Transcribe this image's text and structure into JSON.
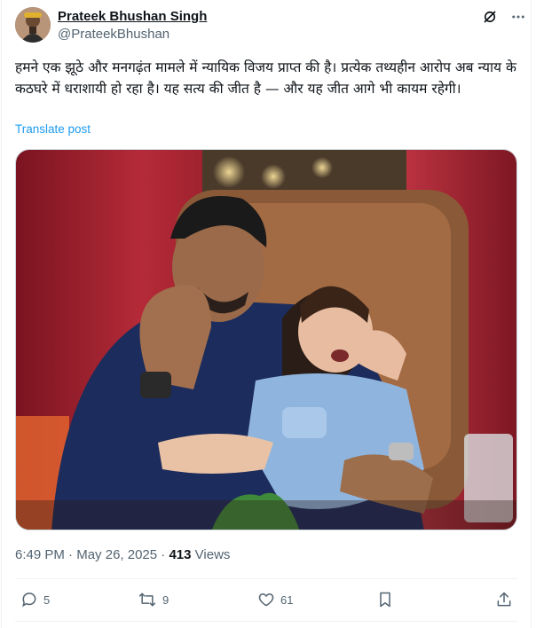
{
  "author": {
    "display_name": "Prateek Bhushan Singh",
    "handle": "@PrateekBhushan"
  },
  "header_icons": [
    "grok-icon",
    "more-icon"
  ],
  "tweet": {
    "text": "हमने एक झूठे और मनगढ़ंत मामले में न्यायिक विजय प्राप्त की है। प्रत्येक तथ्यहीन आरोप अब न्याय के कठघरे में धराशायी हो रहा है। यह सत्य की जीत है — और यह जीत आगे भी कायम रहेगी।",
    "translate_label": "Translate post"
  },
  "meta": {
    "time": "6:49 PM",
    "separator": "·",
    "date": "May 26, 2025",
    "views_count": "413",
    "views_label": "Views"
  },
  "actions": {
    "reply_count": "5",
    "repost_count": "9",
    "like_count": "61",
    "icons": [
      "reply-icon",
      "repost-icon",
      "like-icon",
      "bookmark-icon",
      "share-icon"
    ]
  },
  "colors": {
    "text_primary": "#0f1419",
    "text_secondary": "#536471",
    "link": "#1d9bf0",
    "border": "#eff3f4"
  }
}
